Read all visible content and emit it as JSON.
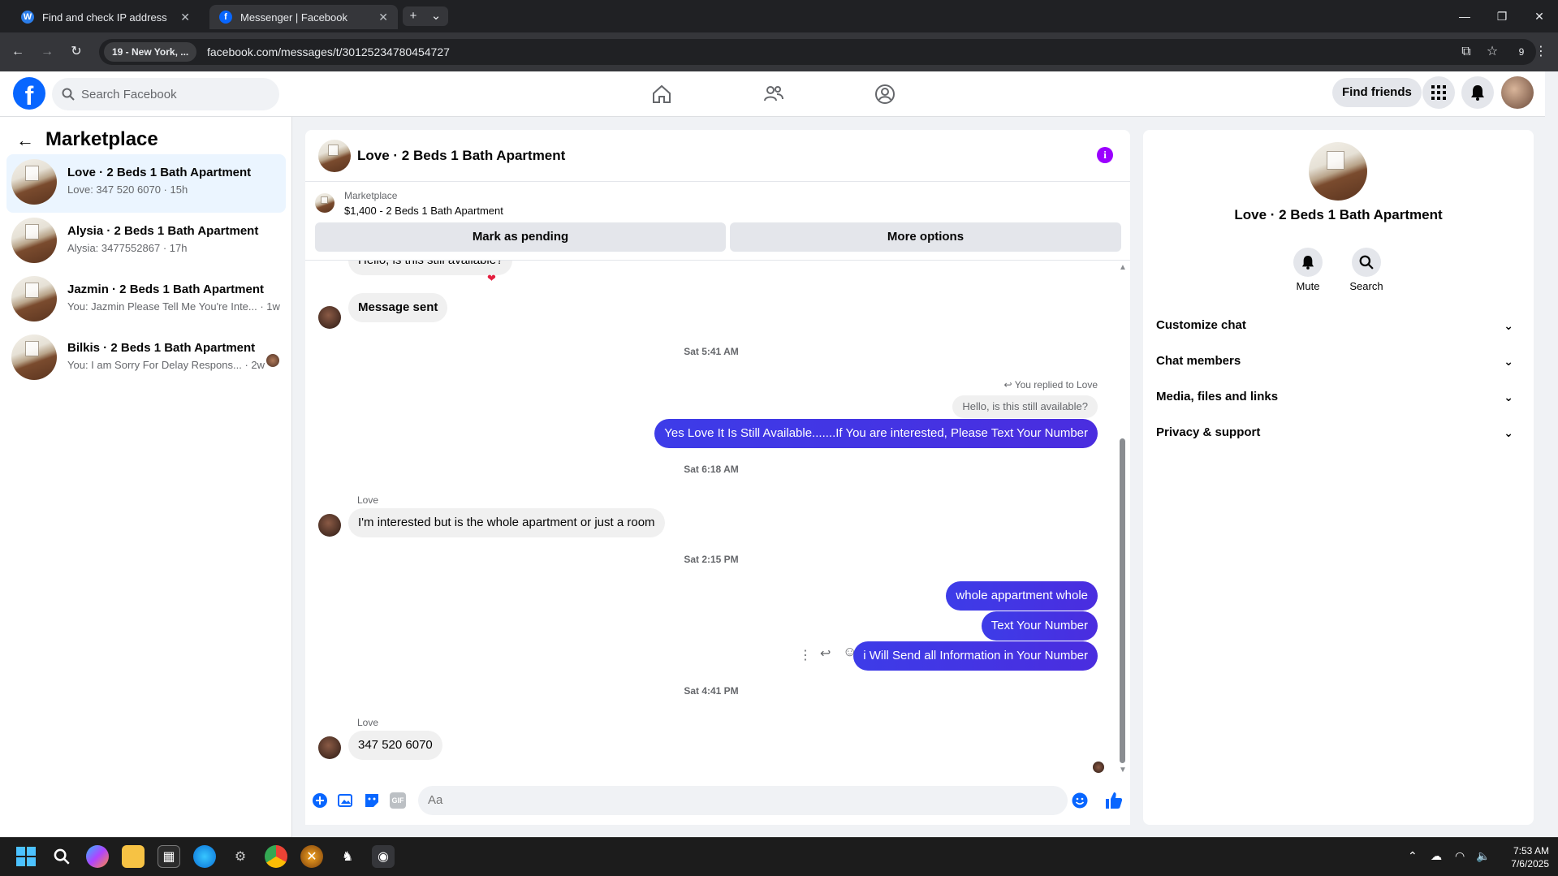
{
  "browser": {
    "tabs": [
      {
        "title": "Find and check IP address",
        "icon": "w-favicon",
        "active": false
      },
      {
        "title": "Messenger | Facebook",
        "icon": "facebook-favicon",
        "active": true
      }
    ],
    "site_chip": "19 - New York, ...",
    "url": "facebook.com/messages/t/30125234780454727",
    "extension_count": "9"
  },
  "header": {
    "search_placeholder": "Search Facebook",
    "find_friends": "Find friends"
  },
  "sidebar": {
    "title": "Marketplace",
    "conversations": [
      {
        "title": "Love · 2 Beds 1 Bath Apartment",
        "snippet": "Love: 347 520 6070 · 15h",
        "active": true
      },
      {
        "title": "Alysia · 2 Beds 1 Bath Apartment",
        "snippet": "Alysia: 3477552867 · 17h",
        "active": false
      },
      {
        "title": "Jazmin · 2 Beds 1 Bath Apartment",
        "snippet": "You: Jazmin Please Tell Me You're Inte... · 1w",
        "active": false
      },
      {
        "title": "Bilkis · 2 Beds 1 Bath Apartment",
        "snippet": "You: I am Sorry For Delay Respons... · 2w",
        "active": false
      }
    ]
  },
  "chat": {
    "title": "Love · 2 Beds 1 Bath Apartment",
    "listing_category": "Marketplace",
    "listing_price": "$1,400 - 2 Beds 1 Bath Apartment",
    "mark_pending": "Mark as pending",
    "more_options": "More options",
    "messages": {
      "top_partial": "Hello, is this still available?",
      "message_sent": "Message sent",
      "ts1": "Sat 5:41 AM",
      "replied_note": "You replied to Love",
      "quoted": "Hello, is this still available?",
      "reply": "Yes Love It Is Still Available.......If You are interested, Please Text Your Number",
      "ts2": "Sat 6:18 AM",
      "sender1": "Love",
      "incoming1": "I'm interested but is the whole apartment or just a room",
      "ts3": "Sat 2:15 PM",
      "out1": "whole appartment whole",
      "out2": "Text Your Number",
      "out3": "i Will Send all Information in Your Number",
      "ts4": "Sat 4:41 PM",
      "sender2": "Love",
      "incoming2": "347 520 6070"
    },
    "composer_placeholder": "Aa"
  },
  "details": {
    "title": "Love · 2 Beds 1 Bath Apartment",
    "mute": "Mute",
    "search": "Search",
    "sections": [
      "Customize chat",
      "Chat members",
      "Media, files and links",
      "Privacy & support"
    ]
  },
  "taskbar": {
    "time": "7:53 AM",
    "date": "7/6/2025"
  },
  "colors": {
    "brand": "#0866ff",
    "outgoing_bubble": "#3d3ce8",
    "info_accent": "#9b00ff"
  }
}
